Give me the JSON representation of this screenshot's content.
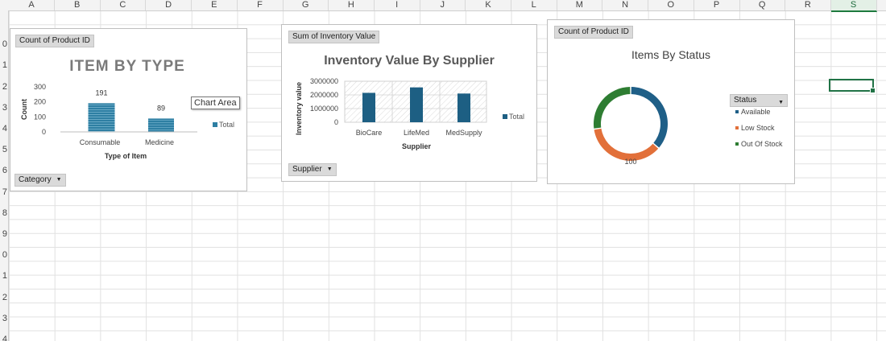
{
  "columns": [
    "A",
    "B",
    "C",
    "D",
    "E",
    "F",
    "G",
    "H",
    "I",
    "J",
    "K",
    "L",
    "M",
    "N",
    "O",
    "P",
    "Q",
    "R",
    "S"
  ],
  "selected_column": "S",
  "rows": [
    "",
    "0",
    "1",
    "2",
    "3",
    "4",
    "5",
    "6",
    "7",
    "8",
    "9",
    "0",
    "1",
    "2",
    "3",
    "4"
  ],
  "tooltip": "Chart Area",
  "charts": {
    "type_chart": {
      "field_button": "Count of Product ID",
      "title": "ITEM BY TYPE",
      "axis_button": "Category",
      "legend": "Total",
      "colors": {
        "bar": "#2e7fa3",
        "text": "#7a7a7a"
      }
    },
    "supplier_chart": {
      "field_button": "Sum of Inventory Value",
      "title": "Inventory Value By Supplier",
      "axis_button": "Supplier",
      "legend": "Total",
      "colors": {
        "bar": "#1d5f83"
      }
    },
    "status_chart": {
      "field_button": "Count of Product ID",
      "title": "Items By Status",
      "filter_button": "Status",
      "data_label": "100",
      "legend": [
        "Available",
        "Low Stock",
        "Out Of Stock"
      ],
      "colors": {
        "Available": "#1f5f87",
        "Low Stock": "#e2703a",
        "Out Of Stock": "#2e7d32"
      }
    }
  },
  "chart_data": [
    {
      "type": "bar",
      "title": "ITEM BY TYPE",
      "xlabel": "Type of Item",
      "ylabel": "Count",
      "categories": [
        "Consumable",
        "Medicine"
      ],
      "series": [
        {
          "name": "Total",
          "values": [
            191,
            89
          ]
        }
      ],
      "ylim": [
        0,
        300
      ],
      "yticks": [
        "300",
        "200",
        "100",
        "0"
      ],
      "grid": false,
      "legend": "right"
    },
    {
      "type": "bar",
      "title": "Inventory Value By Supplier",
      "xlabel": "Supplier",
      "ylabel": "Inventory value",
      "categories": [
        "BioCare",
        "LifeMed",
        "MedSupply"
      ],
      "series": [
        {
          "name": "Total",
          "values": [
            2150000,
            2550000,
            2100000
          ]
        }
      ],
      "ylim": [
        0,
        3000000
      ],
      "yticks": [
        "3000000",
        "2000000",
        "1000000",
        "0"
      ],
      "grid": true,
      "legend": "right"
    },
    {
      "type": "pie",
      "title": "Items By Status",
      "style": "donut",
      "categories": [
        "Available",
        "Low Stock",
        "Out Of Stock"
      ],
      "values": [
        100,
        100,
        75
      ],
      "legend": "right"
    }
  ]
}
